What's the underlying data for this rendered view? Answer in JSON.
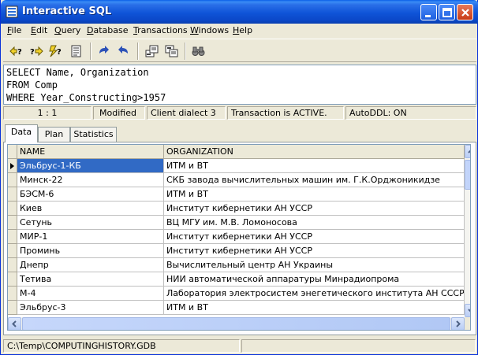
{
  "window": {
    "title": "Interactive SQL"
  },
  "menu": [
    {
      "label": "File",
      "u": "F",
      "rest": "ile"
    },
    {
      "label": "Edit",
      "u": "E",
      "rest": "dit"
    },
    {
      "label": "Query",
      "u": "Q",
      "rest": "uery"
    },
    {
      "label": "Database",
      "u": "D",
      "rest": "atabase"
    },
    {
      "label": "Transactions",
      "u": "T",
      "rest": "ransactions"
    },
    {
      "label": "Windows",
      "u": "W",
      "rest": "indows"
    },
    {
      "label": "Help",
      "u": "H",
      "rest": "elp"
    }
  ],
  "toolbar_icons": [
    "previous-query-icon",
    "next-query-icon",
    "execute-query-icon",
    "query-notes-icon",
    "commit-icon",
    "rollback-icon",
    "export-icon",
    "import-icon",
    "find-icon"
  ],
  "editor": {
    "lines": [
      "SELECT Name, Organization",
      "FROM Comp",
      "WHERE Year_Constructing>1957"
    ]
  },
  "status": {
    "position": "1 :  1",
    "modified": "Modified",
    "dialect": "Client dialect 3",
    "transaction": "Transaction is ACTIVE.",
    "autoddl": "AutoDDL: ON"
  },
  "tabs": [
    "Data",
    "Plan",
    "Statistics"
  ],
  "grid": {
    "columns": [
      "NAME",
      "ORGANIZATION"
    ],
    "rows": [
      [
        "Эльбрус-1-КБ",
        "ИТМ и ВТ"
      ],
      [
        "Минск-22",
        "СКБ завода вычислительных машин им. Г.К.Орджоникидзе"
      ],
      [
        "БЭСМ-6",
        "ИТМ и ВТ"
      ],
      [
        "Киев",
        "Институт кибернетики АН УССР"
      ],
      [
        "Сетунь",
        "ВЦ МГУ им. М.В. Ломоносова"
      ],
      [
        "МИР-1",
        "Институт кибернетики АН УССР"
      ],
      [
        "Проминь",
        "Институт кибернетики АН УССР"
      ],
      [
        "Днепр",
        "Вычислительный центр АН Украины"
      ],
      [
        "Тетива",
        "НИИ автоматической аппаратуры Минрадиопрома"
      ],
      [
        "М-4",
        "Лаборатория электросистем энегетического института АН СССР"
      ],
      [
        "Эльбрус-3",
        "ИТМ и ВТ"
      ]
    ],
    "selected_row": 0
  },
  "statusbar": {
    "path": "C:\\Temp\\COMPUTINGHISTORY.GDB"
  },
  "colors": {
    "titlebar": "#0b48c8",
    "selection": "#316ac5",
    "face": "#ece9d8"
  }
}
